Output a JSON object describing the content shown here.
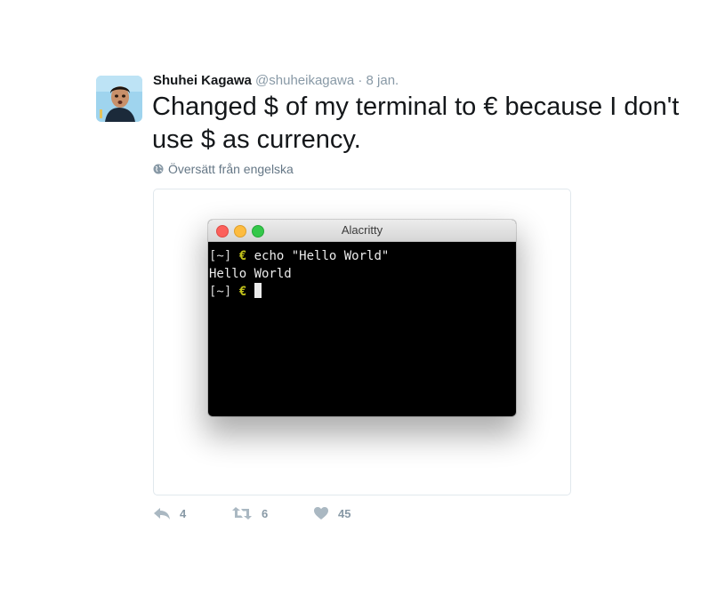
{
  "tweet": {
    "display_name": "Shuhei Kagawa",
    "handle": "@shuheikagawa",
    "separator": "·",
    "date": "8 jan.",
    "text": "Changed $ of my terminal to € because I don't use $ as currency.",
    "translate_label": "Översätt från engelska"
  },
  "terminal": {
    "title": "Alacritty",
    "line1_prompt": "[~]",
    "line1_symbol": "€",
    "line1_command": "echo \"Hello World\"",
    "line2_output": "Hello World",
    "line3_prompt": "[~]",
    "line3_symbol": "€"
  },
  "actions": {
    "reply_count": "4",
    "retweet_count": "6",
    "like_count": "45"
  },
  "icons": {
    "reply": "reply-icon",
    "retweet": "retweet-icon",
    "like": "heart-icon",
    "globe": "globe-icon"
  }
}
